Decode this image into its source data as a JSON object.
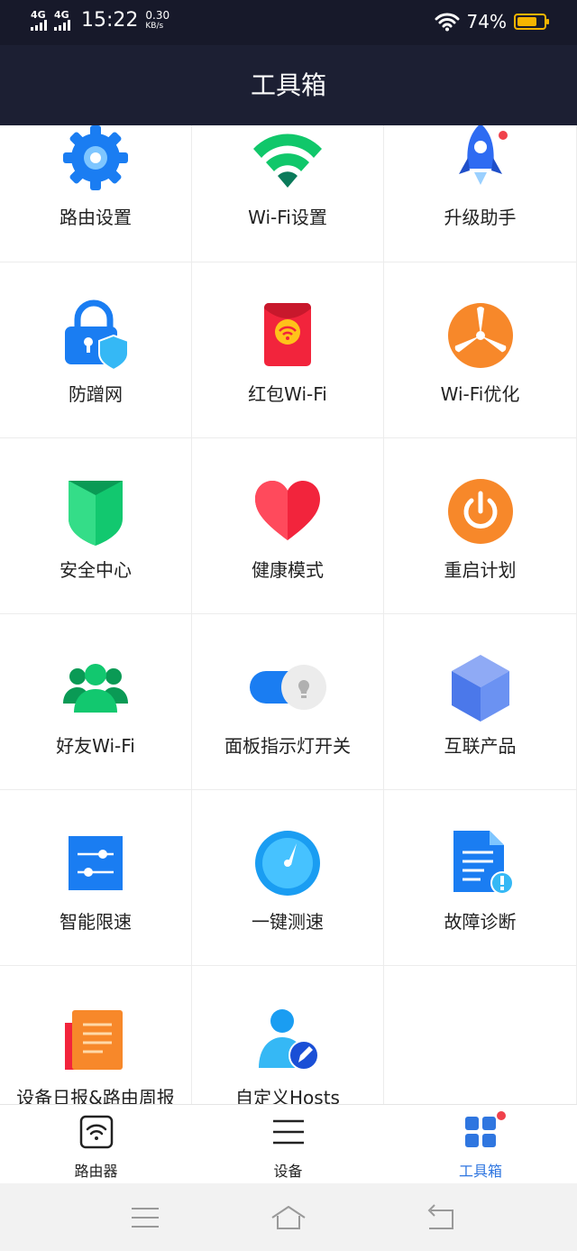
{
  "status_bar": {
    "network1": "4G",
    "network2": "4G",
    "time": "15:22",
    "speed_value": "0.30",
    "speed_unit": "KB/s",
    "battery_percent": "74%",
    "battery_level": 0.74
  },
  "header": {
    "title": "工具箱"
  },
  "tools": [
    {
      "label": "路由设置"
    },
    {
      "label": "Wi-Fi设置"
    },
    {
      "label": "升级助手"
    },
    {
      "label": "防蹭网"
    },
    {
      "label": "红包Wi-Fi"
    },
    {
      "label": "Wi-Fi优化"
    },
    {
      "label": "安全中心"
    },
    {
      "label": "健康模式"
    },
    {
      "label": "重启计划"
    },
    {
      "label": "好友Wi-Fi"
    },
    {
      "label": "面板指示灯开关"
    },
    {
      "label": "互联产品"
    },
    {
      "label": "智能限速"
    },
    {
      "label": "一键测速"
    },
    {
      "label": "故障诊断"
    },
    {
      "label": "设备日报&路由周报"
    },
    {
      "label": "自定义Hosts"
    }
  ],
  "tabs": [
    {
      "label": "路由器",
      "icon": "router-icon"
    },
    {
      "label": "设备",
      "icon": "list-icon"
    },
    {
      "label": "工具箱",
      "icon": "grid-icon",
      "active": true
    }
  ],
  "colors": {
    "accent": "#2f76e0",
    "header_bg": "#1c1f33",
    "badge": "#f0414b"
  }
}
